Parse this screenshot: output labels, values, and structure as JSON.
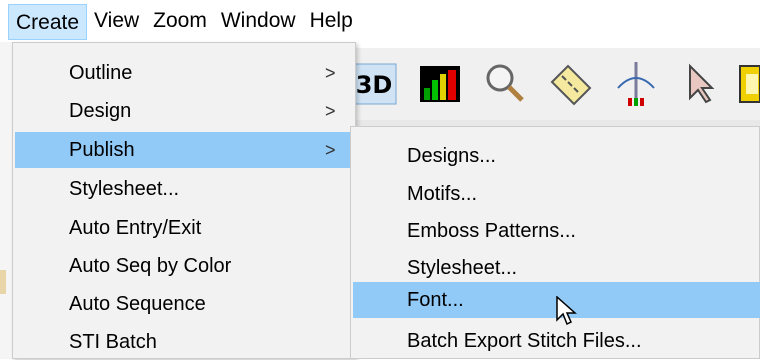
{
  "menubar": {
    "items": [
      {
        "label": "Create"
      },
      {
        "label": "View"
      },
      {
        "label": "Zoom"
      },
      {
        "label": "Window"
      },
      {
        "label": "Help"
      }
    ]
  },
  "toolbar": {
    "icons": [
      "3d-view-icon",
      "bar-chart-icon",
      "magnifier-icon",
      "ruler-icon",
      "needle-icon",
      "pointer-icon",
      "spool-icon"
    ],
    "three_d_label": "3D"
  },
  "create_menu": {
    "items": [
      {
        "label": "Outline",
        "submenu": true
      },
      {
        "label": "Design",
        "submenu": true
      },
      {
        "label": "Publish",
        "submenu": true,
        "highlighted": true
      },
      {
        "label": "Stylesheet...",
        "submenu": false
      },
      {
        "label": "Auto Entry/Exit",
        "submenu": false
      },
      {
        "label": "Auto Seq by Color",
        "submenu": false
      },
      {
        "label": "Auto Sequence",
        "submenu": false
      },
      {
        "label": "STI Batch",
        "submenu": false
      }
    ],
    "arrow_glyph": ">"
  },
  "publish_menu": {
    "items": [
      {
        "label": "Designs..."
      },
      {
        "label": "Motifs..."
      },
      {
        "label": "Emboss Patterns..."
      },
      {
        "label": "Stylesheet..."
      },
      {
        "label": "Font...",
        "highlighted": true
      },
      {
        "label": "Batch Export Stitch Files..."
      }
    ]
  },
  "colors": {
    "highlight": "#91c9f7",
    "menu_bg": "#f2f2f2"
  }
}
